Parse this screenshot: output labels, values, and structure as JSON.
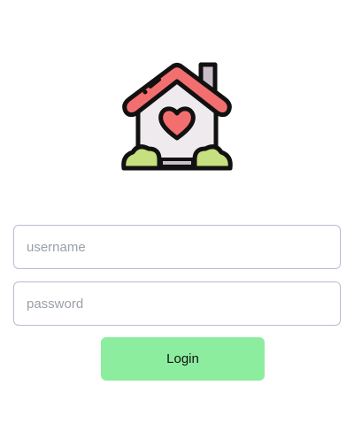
{
  "logo": {
    "icon": "house-heart-icon",
    "colors": {
      "roof": "#f36f6f",
      "wall": "#eeeaee",
      "heart": "#f36f6f",
      "bush": "#c6df7f",
      "outline": "#111111",
      "chimney": "#c9bfc9"
    }
  },
  "form": {
    "username_placeholder": "username",
    "password_placeholder": "password",
    "login_label": "Login"
  },
  "colors": {
    "button_bg": "#8ded9e",
    "input_border": "#b9bdd3",
    "placeholder": "#9aa0a8"
  }
}
